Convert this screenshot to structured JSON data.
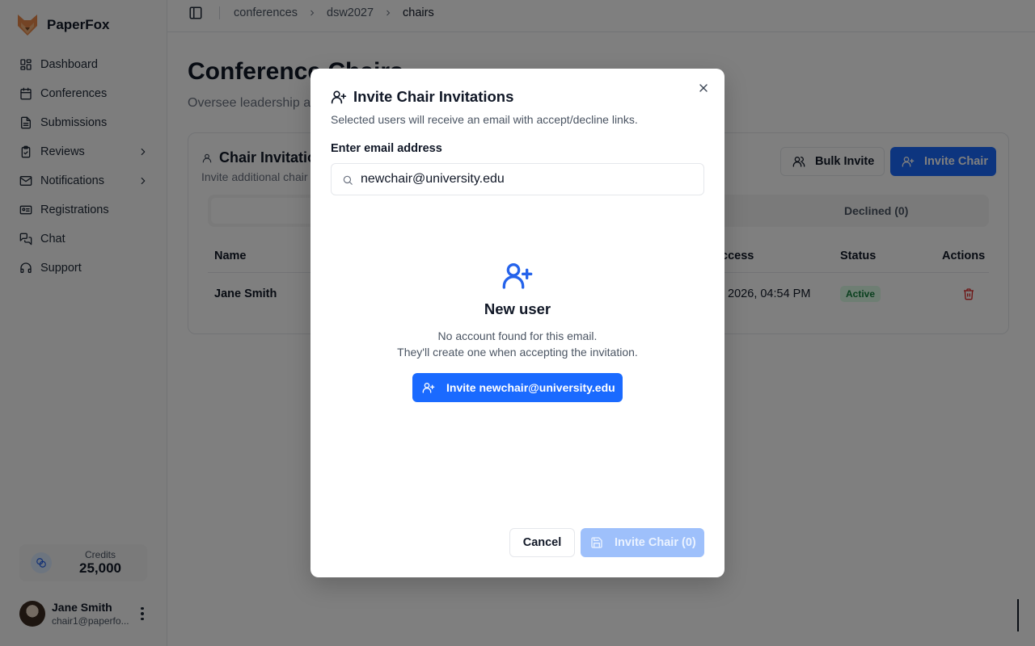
{
  "app": {
    "name": "PaperFox"
  },
  "sidebar": {
    "items": [
      {
        "label": "Dashboard",
        "icon": "dashboard-icon"
      },
      {
        "label": "Conferences",
        "icon": "calendar-icon"
      },
      {
        "label": "Submissions",
        "icon": "document-icon"
      },
      {
        "label": "Reviews",
        "icon": "clipboard-check-icon",
        "has_submenu": true
      },
      {
        "label": "Notifications",
        "icon": "mail-icon",
        "has_submenu": true
      },
      {
        "label": "Registrations",
        "icon": "id-card-icon"
      },
      {
        "label": "Chat",
        "icon": "chat-icon"
      },
      {
        "label": "Support",
        "icon": "headset-icon"
      }
    ],
    "credits": {
      "label": "Credits",
      "value": "25,000"
    },
    "user": {
      "name": "Jane Smith",
      "email": "chair1@paperfo..."
    }
  },
  "breadcrumb": {
    "items": [
      "conferences",
      "dsw2027",
      "chairs"
    ]
  },
  "page": {
    "title": "Conference Chairs",
    "subtitle": "Oversee leadership a"
  },
  "card": {
    "title": "Chair Invitatio",
    "subtitle": "Invite additional chair",
    "bulk_invite_label": "Bulk Invite",
    "invite_chair_label": "Invite Chair",
    "tab_declined": "Declined (0)",
    "columns": {
      "name": "Name",
      "last_access": "ccess",
      "status": "Status",
      "actions": "Actions"
    },
    "rows": [
      {
        "name": "Jane Smith",
        "last_access": ", 2026, 04:54 PM",
        "status": "Active"
      }
    ]
  },
  "modal": {
    "title": "Invite Chair Invitations",
    "description": "Selected users will receive an email with accept/decline links.",
    "email_label": "Enter email address",
    "email_value": "newchair@university.edu",
    "new_user_title": "New user",
    "new_user_line1": "No account found for this email.",
    "new_user_line2": "They'll create one when accepting the invitation.",
    "invite_button_label": "Invite newchair@university.edu",
    "cancel_label": "Cancel",
    "submit_label": "Invite Chair (0)"
  },
  "colors": {
    "accent": "#1a6aff",
    "accent_disabled": "#9ec0fb",
    "success_bg": "#dcfce7",
    "success_text": "#15803d",
    "danger": "#dc2626"
  }
}
